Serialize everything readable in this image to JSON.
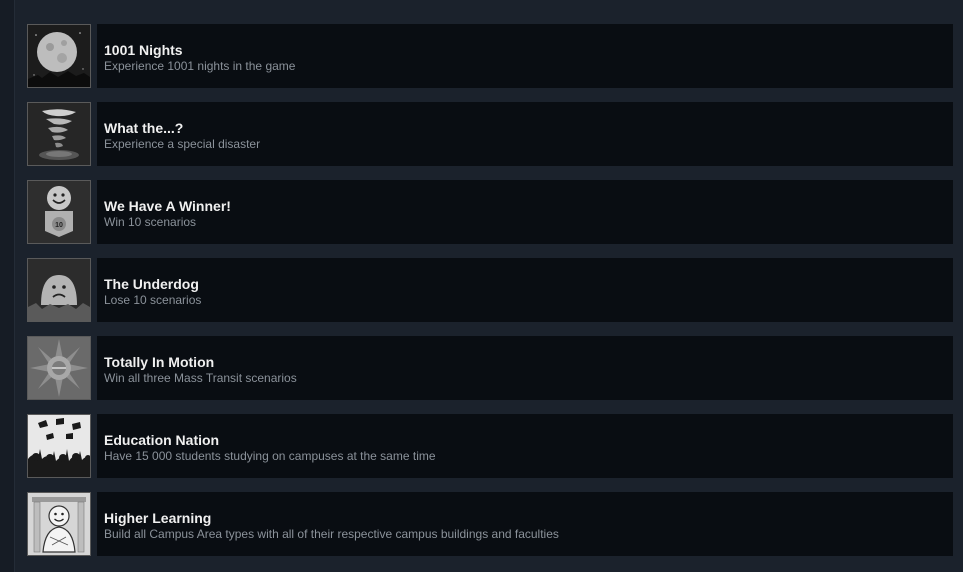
{
  "achievements": [
    {
      "title": "1001 Nights",
      "description": "Experience 1001 nights in the game",
      "icon": "moon-icon"
    },
    {
      "title": "What the...?",
      "description": "Experience a special disaster",
      "icon": "tornado-icon"
    },
    {
      "title": "We Have A Winner!",
      "description": "Win 10 scenarios",
      "icon": "smiley-medal-icon"
    },
    {
      "title": "The Underdog",
      "description": "Lose 10 scenarios",
      "icon": "sad-face-icon"
    },
    {
      "title": "Totally In Motion",
      "description": "Win all three Mass Transit scenarios",
      "icon": "sunburst-icon"
    },
    {
      "title": "Education Nation",
      "description": "Have 15 000 students studying on campuses at the same time",
      "icon": "graduation-crowd-icon"
    },
    {
      "title": "Higher Learning",
      "description": "Build all Campus Area types with all of their respective campus buildings and faculties",
      "icon": "scholar-statue-icon"
    }
  ],
  "medal_number": "10"
}
